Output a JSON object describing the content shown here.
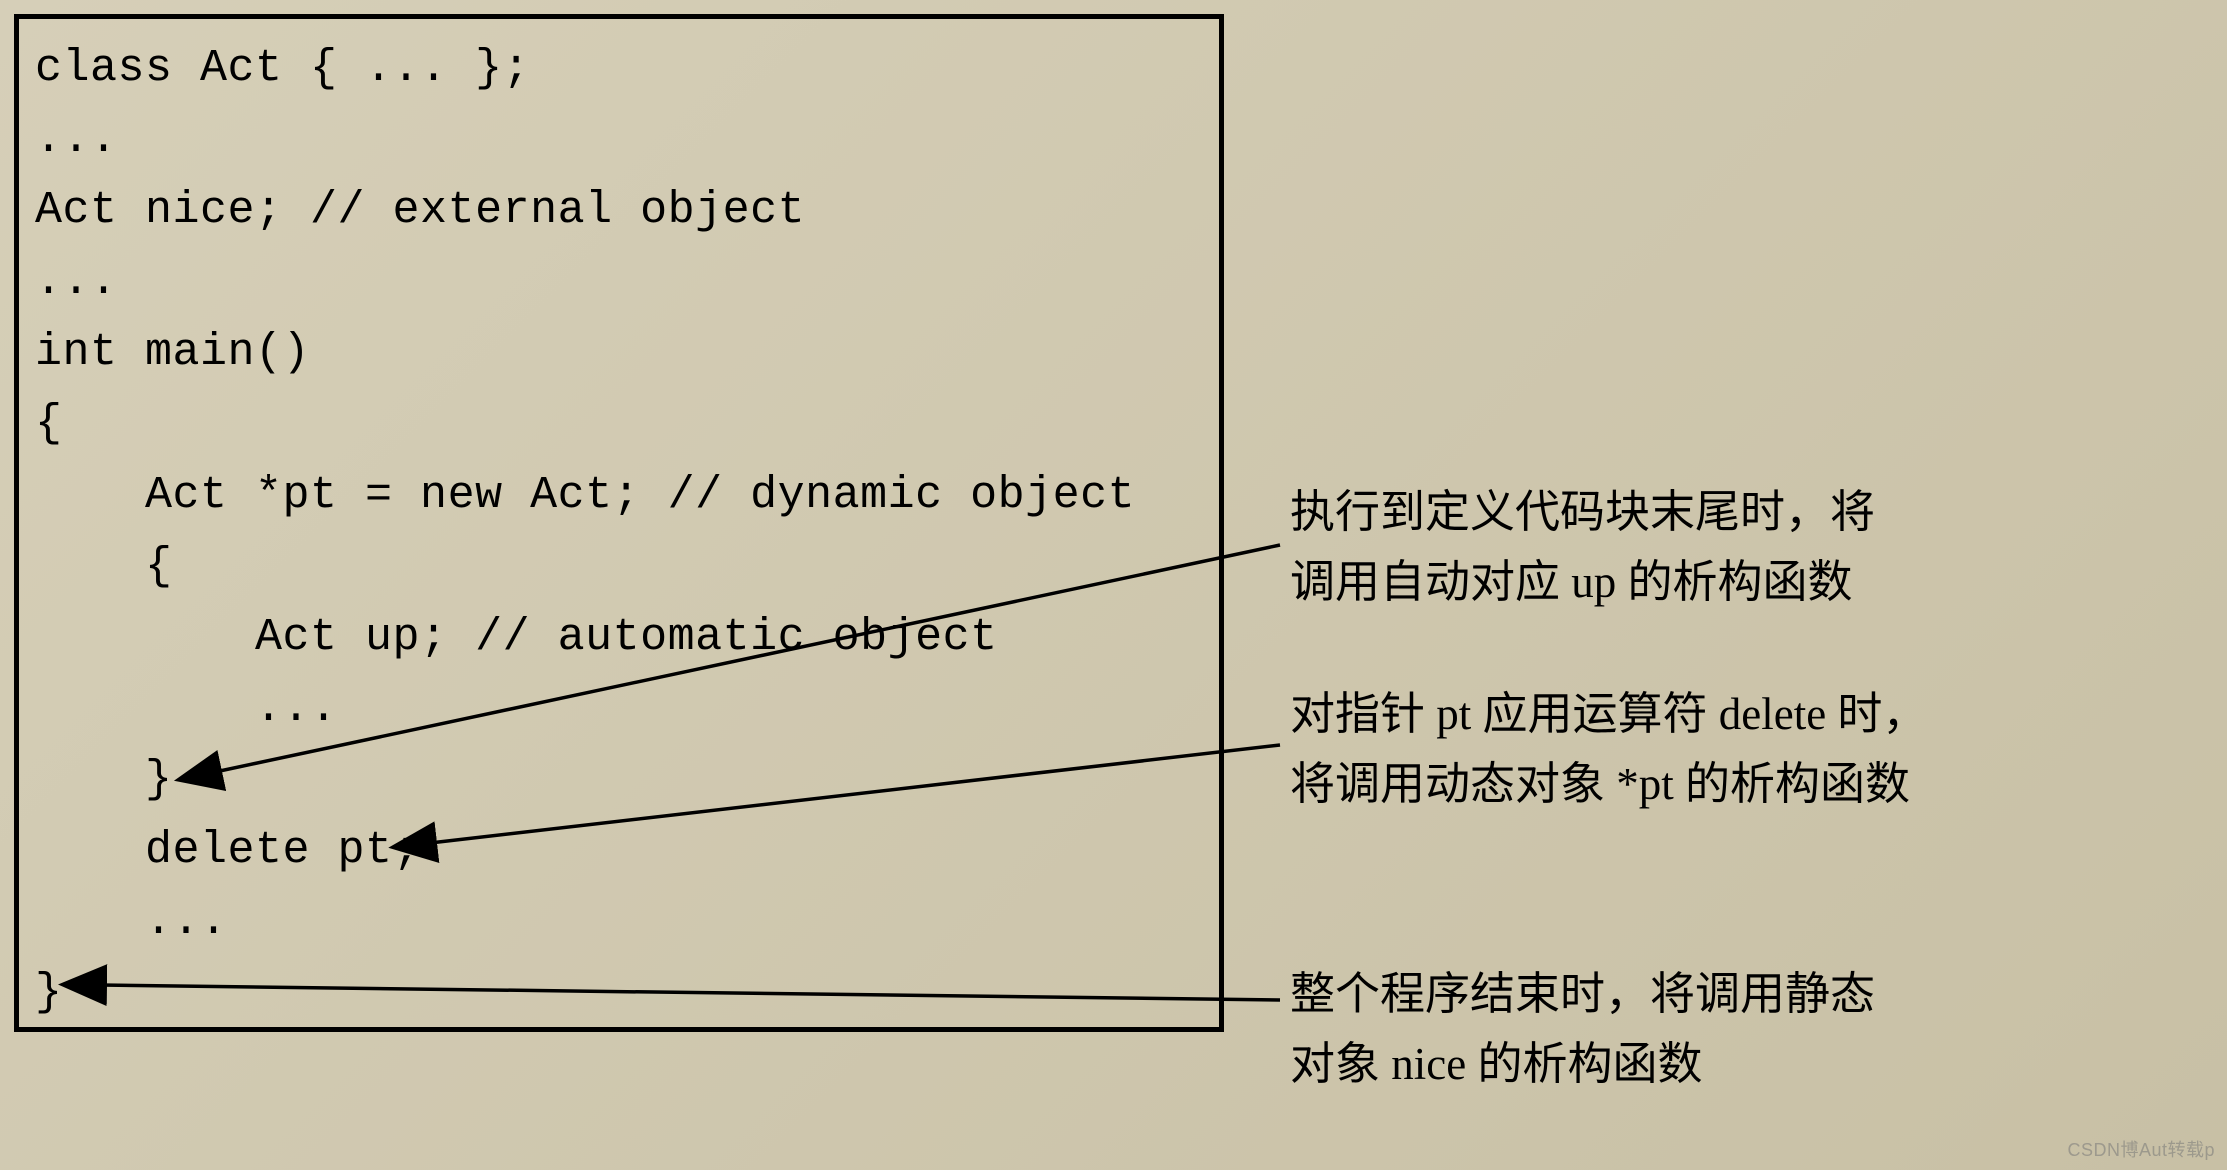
{
  "code": {
    "lines": [
      "class Act { ... };",
      "...",
      "Act nice; // external object",
      "...",
      "int main()",
      "{",
      "    Act *pt = new Act; // dynamic object",
      "    {",
      "        Act up; // automatic object",
      "        ...",
      "    }",
      "    delete pt;",
      "    ...",
      "}"
    ]
  },
  "annotations": {
    "a1": "执行到定义代码块末尾时，将\n调用自动对应 up 的析构函数",
    "a2": "对指针 pt 应用运算符 delete 时，\n将调用动态对象 *pt 的析构函数",
    "a3": "整个程序结束时，将调用静态\n对象 nice 的析构函数"
  },
  "watermark": "CSDN博Aut转载p"
}
